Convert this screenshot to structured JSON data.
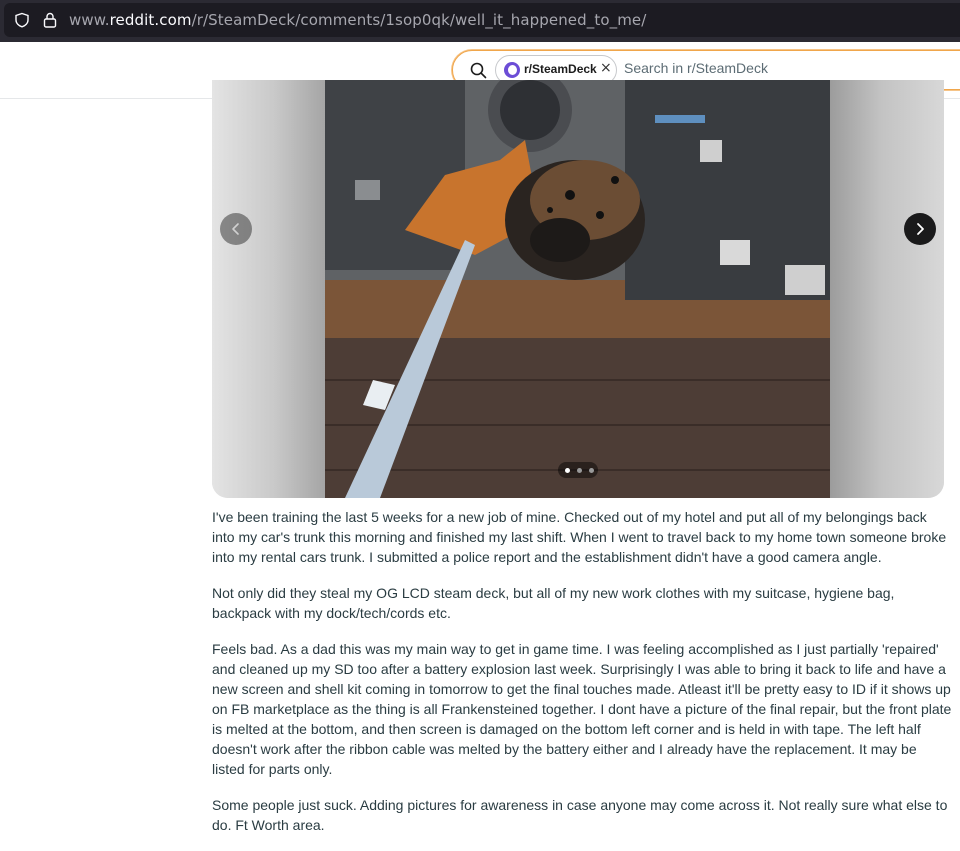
{
  "browser": {
    "url_prefix": "www.",
    "url_domain": "reddit.com",
    "url_path": "/r/SteamDeck/comments/1sop0qk/well_it_happened_to_me/",
    "icons": [
      "shield-icon",
      "lock-icon"
    ]
  },
  "header": {
    "search": {
      "community_chip": "r/SteamDeck",
      "chip_remove": "×",
      "placeholder": "Search in r/SteamDeck"
    }
  },
  "gallery": {
    "current_image": 1,
    "image_count": 3,
    "icons": [
      "chevron-left-icon",
      "chevron-right-icon"
    ]
  },
  "post": {
    "paragraphs": [
      "I've been training the last 5 weeks for a new job of mine. Checked out of my hotel and put all of my belongings back into my car's trunk this morning and finished my last shift. When I went to travel back to my home town someone broke into my rental cars trunk. I submitted a police report and the establishment didn't have a good camera angle.",
      "Not only did they steal my OG LCD steam deck, but all of my new work clothes with my suitcase, hygiene bag, backpack with my dock/tech/cords etc.",
      "Feels bad. As a dad this was my main way to get in game time. I was feeling accomplished as I just partially 'repaired' and cleaned up my SD too after a battery explosion last week. Surprisingly I was able to bring it back to life and have a new screen and shell kit coming in tomorrow to get the final touches made. Atleast it'll be pretty easy to ID if it shows up on FB marketplace as the thing is all Frankensteined together. I dont have a picture of the final repair, but the front plate is melted at the bottom, and then screen is damaged on the bottom left corner and is held in with tape. The left half doesn't work after the ribbon cable was melted by the battery either and I already have the replacement. It may be listed for parts only.",
      "Some people just suck. Adding pictures for awareness in case anyone may come across it. Not really sure what else to do. Ft Worth area."
    ]
  }
}
